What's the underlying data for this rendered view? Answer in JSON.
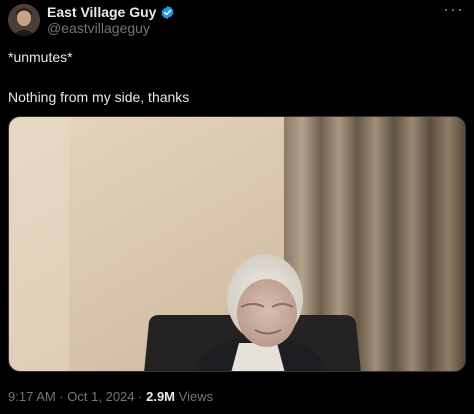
{
  "tweet": {
    "author": {
      "display_name": "East Village Guy",
      "handle": "@eastvillageguy",
      "verified": true
    },
    "text_lines": [
      "*unmutes*",
      "Nothing from my side, thanks"
    ],
    "meta": {
      "time": "9:17 AM",
      "separator": "·",
      "date": "Oct 1, 2024",
      "views_count": "2.9M",
      "views_label": "Views"
    }
  },
  "icons": {
    "verified": "verified-badge-icon",
    "more": "more-options-icon"
  },
  "colors": {
    "background": "#000000",
    "text_primary": "#e7e9ea",
    "text_secondary": "#71767b",
    "verified_blue": "#1d9bf0"
  }
}
